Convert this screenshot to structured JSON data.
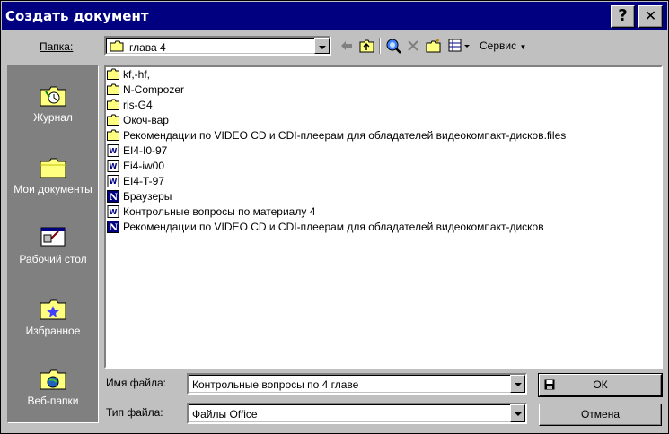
{
  "window": {
    "title": "Создать документ",
    "help_label": "?",
    "close_label": "✕"
  },
  "folder_bar": {
    "label": "Папка:",
    "current_folder": "глава 4",
    "service_label": "Сервис"
  },
  "places": [
    {
      "label": "Журнал",
      "icon": "history-icon"
    },
    {
      "label": "Мои документы",
      "icon": "my-documents-icon"
    },
    {
      "label": "Рабочий стол",
      "icon": "desktop-icon"
    },
    {
      "label": "Избранное",
      "icon": "favorites-icon"
    },
    {
      "label": "Веб-папки",
      "icon": "web-folders-icon"
    }
  ],
  "files": [
    {
      "name": "kf,-hf,",
      "type": "folder"
    },
    {
      "name": "N-Compozer",
      "type": "folder"
    },
    {
      "name": "ris-G4",
      "type": "folder"
    },
    {
      "name": "Окоч-вар",
      "type": "folder"
    },
    {
      "name": "Рекомендации по VIDEO CD и CDI-плеерам для обладателей видеокомпакт-дисков.files",
      "type": "folder"
    },
    {
      "name": "EI4-I0-97",
      "type": "word"
    },
    {
      "name": "Ei4-iw00",
      "type": "word"
    },
    {
      "name": "EI4-T-97",
      "type": "word"
    },
    {
      "name": "Браузеры",
      "type": "html"
    },
    {
      "name": "Контрольные вопросы по материалу 4",
      "type": "word"
    },
    {
      "name": "Рекомендации по VIDEO CD и CDI-плеерам для обладателей видеокомпакт-дисков",
      "type": "html"
    }
  ],
  "filename": {
    "label": "Имя файла:",
    "value": "Контрольные вопросы по 4 главе"
  },
  "filetype": {
    "label": "Тип файла:",
    "value": "Файлы Office"
  },
  "buttons": {
    "ok": "ОК",
    "cancel": "Отмена"
  },
  "colors": {
    "titlebar": "#000080",
    "face": "#c0c0c0",
    "sidebar": "#808080"
  }
}
